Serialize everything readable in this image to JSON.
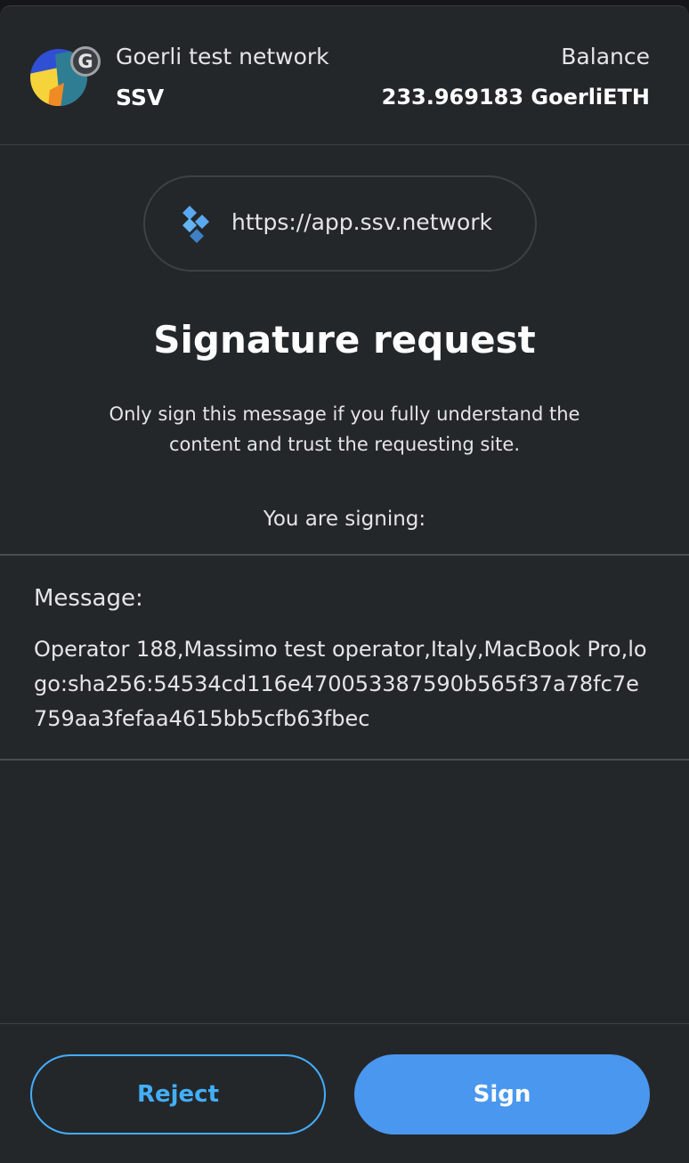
{
  "header": {
    "network_name": "Goerli test network",
    "network_badge": "G",
    "account_name": "SSV",
    "balance_label": "Balance",
    "balance_value": "233.969183 GoerliETH"
  },
  "origin": {
    "url": "https://app.ssv.network",
    "icon": "ssv-diamond-logo"
  },
  "request": {
    "title": "Signature request",
    "warning": "Only sign this message if you fully understand the content and trust the requesting site.",
    "signing_label": "You are signing:"
  },
  "message": {
    "label": "Message:",
    "text": "Operator 188,Massimo test operator,Italy,MacBook Pro,logo:sha256:54534cd116e470053387590b565f37a78fc7e759aa3fefaa4615bb5cfb63fbec"
  },
  "actions": {
    "reject_label": "Reject",
    "sign_label": "Sign"
  },
  "colors": {
    "background": "#24272a",
    "primary": "#4a97f0",
    "reject_text": "#43aefc"
  }
}
